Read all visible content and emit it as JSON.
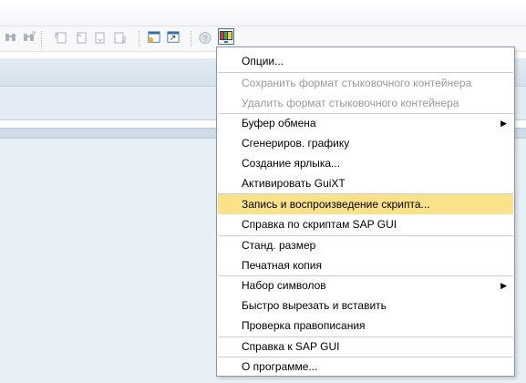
{
  "toolbar": {
    "icons": [
      "find-icon",
      "find-next-icon",
      "first-page-icon",
      "previous-page-icon",
      "next-page-icon",
      "last-page-icon",
      "create-session-icon",
      "create-shortcut-icon",
      "help-icon",
      "customize-layout-icon"
    ]
  },
  "menu": {
    "items": [
      {
        "label": "Опции...",
        "disabled": false
      },
      {
        "label": "Сохранить формат стыковочного контейнера",
        "disabled": true
      },
      {
        "label": "Удалить формат стыковочного контейнера",
        "disabled": true
      },
      {
        "label": "Буфер обмена",
        "submenu": true
      },
      {
        "label": "Сгенериров. графику"
      },
      {
        "label": "Создание ярлыка..."
      },
      {
        "label": "Активировать GuiXT"
      },
      {
        "label": "Запись и воспроизведение скрипта...",
        "highlighted": true
      },
      {
        "label": "Справка по скриптам SAP GUI"
      },
      {
        "label": "Станд. размер"
      },
      {
        "label": "Печатная копия"
      },
      {
        "label": "Набор символов",
        "submenu": true
      },
      {
        "label": "Быстро вырезать и вставить"
      },
      {
        "label": "Проверка правописания"
      },
      {
        "label": "Справка к SAP GUI"
      },
      {
        "label": "О программе..."
      }
    ],
    "submenu_arrow": "▶"
  },
  "colors": {
    "highlight": "#fbe28a",
    "disabled_text": "#9a9a9a",
    "background_blue": "#e8f0f7"
  }
}
